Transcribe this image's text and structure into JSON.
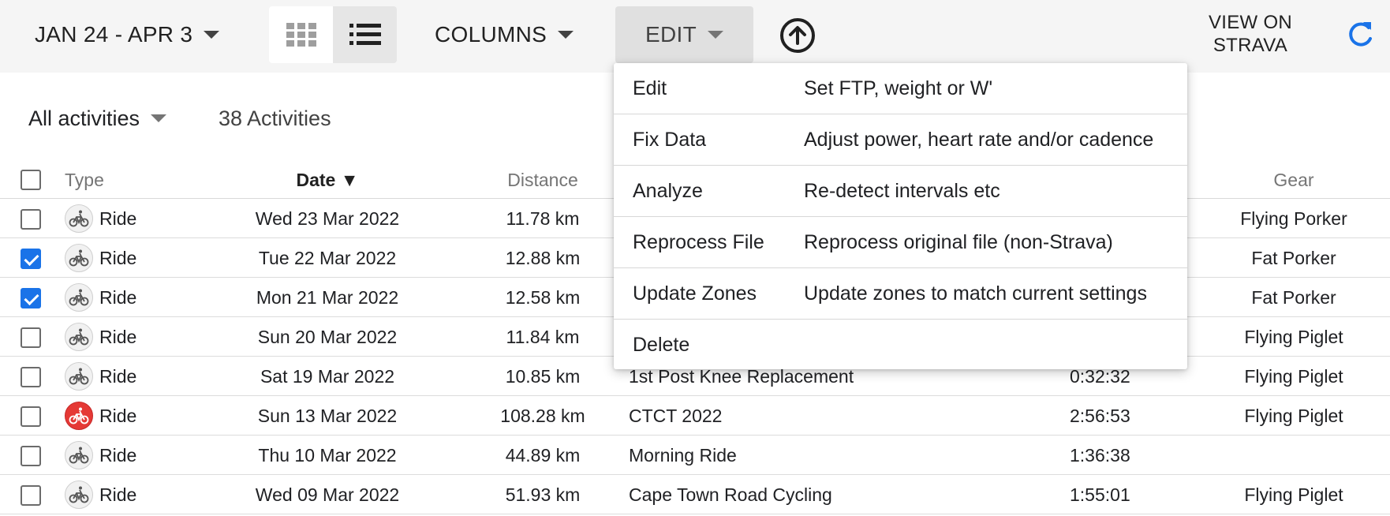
{
  "toolbar": {
    "date_range": "JAN 24 - APR 3",
    "columns_label": "COLUMNS",
    "edit_label": "EDIT",
    "view_on_strava_line1": "VIEW ON",
    "view_on_strava_line2": "STRAVA",
    "accent_color": "#1a73e8"
  },
  "filter": {
    "selected": "All activities",
    "count": "38 Activities"
  },
  "table": {
    "headers": {
      "type": "Type",
      "date": "Date ▼",
      "distance": "Distance",
      "gear": "Gear"
    },
    "rows": [
      {
        "checked": false,
        "type": "Ride",
        "icon": "bike-icon",
        "date": "Wed 23 Mar 2022",
        "distance": "11.78 km",
        "name": "",
        "time": "",
        "gear": "Flying Porker"
      },
      {
        "checked": true,
        "type": "Ride",
        "icon": "bike-icon",
        "date": "Tue 22 Mar 2022",
        "distance": "12.88 km",
        "name": "",
        "time": "",
        "gear": "Fat Porker"
      },
      {
        "checked": true,
        "type": "Ride",
        "icon": "bike-icon",
        "date": "Mon 21 Mar 2022",
        "distance": "12.58 km",
        "name": "",
        "time": "",
        "gear": "Fat Porker"
      },
      {
        "checked": false,
        "type": "Ride",
        "icon": "bike-icon",
        "date": "Sun 20 Mar 2022",
        "distance": "11.84 km",
        "name": "",
        "time": "",
        "gear": "Flying Piglet"
      },
      {
        "checked": false,
        "type": "Ride",
        "icon": "bike-icon",
        "date": "Sat 19 Mar 2022",
        "distance": "10.85 km",
        "name": "1st Post Knee Replacement",
        "time": "0:32:32",
        "gear": "Flying Piglet"
      },
      {
        "checked": false,
        "type": "Ride",
        "icon": "bike-icon-red",
        "date": "Sun 13 Mar 2022",
        "distance": "108.28 km",
        "name": "CTCT 2022",
        "time": "2:56:53",
        "gear": "Flying Piglet"
      },
      {
        "checked": false,
        "type": "Ride",
        "icon": "bike-icon",
        "date": "Thu 10 Mar 2022",
        "distance": "44.89 km",
        "name": "Morning Ride",
        "time": "1:36:38",
        "gear": ""
      },
      {
        "checked": false,
        "type": "Ride",
        "icon": "bike-icon",
        "date": "Wed 09 Mar 2022",
        "distance": "51.93 km",
        "name": "Cape Town Road Cycling",
        "time": "1:55:01",
        "gear": "Flying Piglet"
      }
    ]
  },
  "edit_menu": {
    "items": [
      {
        "label": "Edit",
        "description": "Set FTP, weight or W'"
      },
      {
        "label": "Fix Data",
        "description": "Adjust power, heart rate and/or cadence"
      },
      {
        "label": "Analyze",
        "description": "Re-detect intervals etc"
      },
      {
        "label": "Reprocess File",
        "description": "Reprocess original file (non-Strava)"
      },
      {
        "label": "Update Zones",
        "description": "Update zones to match current settings"
      },
      {
        "label": "Delete",
        "description": ""
      }
    ]
  }
}
